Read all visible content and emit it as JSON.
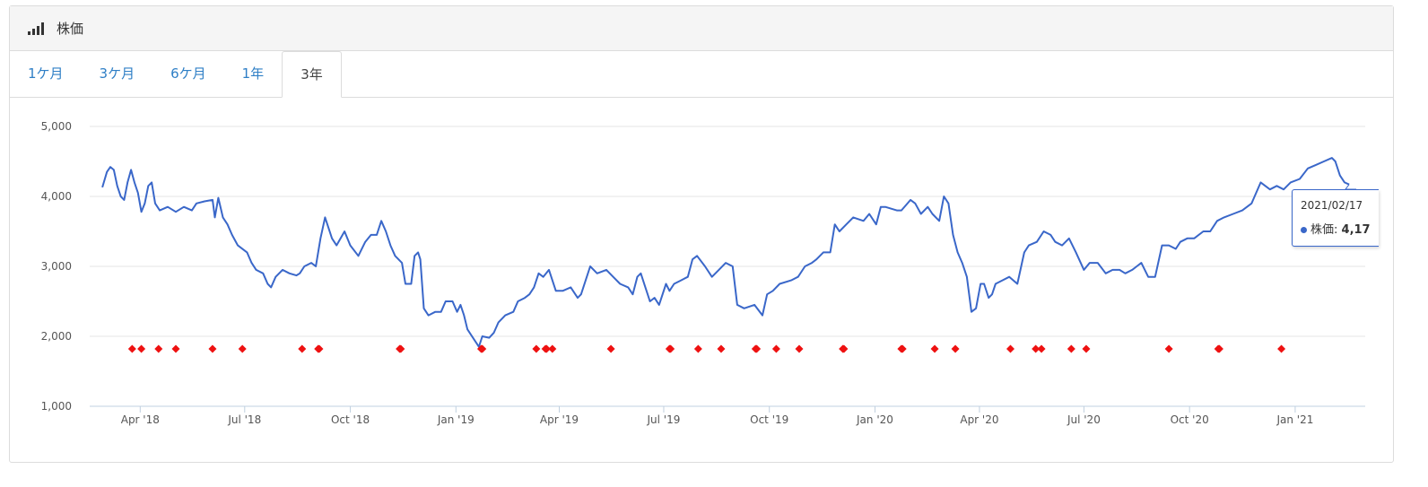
{
  "header": {
    "icon": "signal-bars-icon",
    "title": "株価"
  },
  "tabs": [
    {
      "label": "1ケ月",
      "active": false
    },
    {
      "label": "3ケ月",
      "active": false
    },
    {
      "label": "6ケ月",
      "active": false
    },
    {
      "label": "1年",
      "active": false
    },
    {
      "label": "3年",
      "active": true
    }
  ],
  "tooltip": {
    "date": "2021/02/17",
    "series_label": "株価",
    "value": "4,17"
  },
  "colors": {
    "line": "#3a67c9",
    "marker": "#ee1111",
    "grid": "#e6e6e6",
    "axis": "#c0d0e0"
  },
  "chart_data": {
    "type": "line",
    "ylim": [
      1000,
      5000
    ],
    "xlim": [
      "2018-02-16",
      "2021-03-03"
    ],
    "y_ticks": [
      "1,000",
      "2,000",
      "3,000",
      "4,000",
      "5,000"
    ],
    "x_ticks": [
      {
        "label": "Apr '18",
        "date": "2018-04-01"
      },
      {
        "label": "Jul '18",
        "date": "2018-07-01"
      },
      {
        "label": "Oct '18",
        "date": "2018-10-01"
      },
      {
        "label": "Jan '19",
        "date": "2019-01-01"
      },
      {
        "label": "Apr '19",
        "date": "2019-04-01"
      },
      {
        "label": "Jul '19",
        "date": "2019-07-01"
      },
      {
        "label": "Oct '19",
        "date": "2019-10-01"
      },
      {
        "label": "Jan '20",
        "date": "2020-01-01"
      },
      {
        "label": "Apr '20",
        "date": "2020-04-01"
      },
      {
        "label": "Jul '20",
        "date": "2020-07-01"
      },
      {
        "label": "Oct '20",
        "date": "2020-10-01"
      },
      {
        "label": "Jan '21",
        "date": "2021-01-01"
      }
    ],
    "grid": true,
    "series": [
      {
        "values": [
          [
            "2018-02-27",
            4130
          ],
          [
            "2018-03-03",
            4350
          ],
          [
            "2018-03-06",
            4420
          ],
          [
            "2018-03-09",
            4380
          ],
          [
            "2018-03-12",
            4150
          ],
          [
            "2018-03-15",
            4000
          ],
          [
            "2018-03-18",
            3950
          ],
          [
            "2018-03-21",
            4200
          ],
          [
            "2018-03-24",
            4380
          ],
          [
            "2018-03-27",
            4200
          ],
          [
            "2018-03-30",
            4050
          ],
          [
            "2018-04-02",
            3780
          ],
          [
            "2018-04-05",
            3900
          ],
          [
            "2018-04-08",
            4150
          ],
          [
            "2018-04-11",
            4200
          ],
          [
            "2018-04-14",
            3900
          ],
          [
            "2018-04-18",
            3800
          ],
          [
            "2018-04-25",
            3850
          ],
          [
            "2018-05-02",
            3780
          ],
          [
            "2018-05-09",
            3850
          ],
          [
            "2018-05-16",
            3800
          ],
          [
            "2018-05-20",
            3900
          ],
          [
            "2018-05-27",
            3930
          ],
          [
            "2018-06-03",
            3950
          ],
          [
            "2018-06-05",
            3700
          ],
          [
            "2018-06-08",
            3980
          ],
          [
            "2018-06-12",
            3700
          ],
          [
            "2018-06-16",
            3600
          ],
          [
            "2018-06-20",
            3450
          ],
          [
            "2018-06-25",
            3300
          ],
          [
            "2018-07-03",
            3200
          ],
          [
            "2018-07-07",
            3050
          ],
          [
            "2018-07-11",
            2950
          ],
          [
            "2018-07-17",
            2900
          ],
          [
            "2018-07-21",
            2750
          ],
          [
            "2018-07-24",
            2700
          ],
          [
            "2018-07-28",
            2850
          ],
          [
            "2018-08-03",
            2950
          ],
          [
            "2018-08-09",
            2900
          ],
          [
            "2018-08-15",
            2870
          ],
          [
            "2018-08-18",
            2900
          ],
          [
            "2018-08-22",
            3000
          ],
          [
            "2018-08-28",
            3050
          ],
          [
            "2018-09-01",
            3000
          ],
          [
            "2018-09-05",
            3400
          ],
          [
            "2018-09-09",
            3700
          ],
          [
            "2018-09-15",
            3400
          ],
          [
            "2018-09-19",
            3300
          ],
          [
            "2018-09-26",
            3500
          ],
          [
            "2018-10-01",
            3300
          ],
          [
            "2018-10-08",
            3150
          ],
          [
            "2018-10-14",
            3350
          ],
          [
            "2018-10-19",
            3450
          ],
          [
            "2018-10-24",
            3450
          ],
          [
            "2018-10-28",
            3650
          ],
          [
            "2018-11-01",
            3500
          ],
          [
            "2018-11-05",
            3300
          ],
          [
            "2018-11-09",
            3150
          ],
          [
            "2018-11-15",
            3050
          ],
          [
            "2018-11-18",
            2750
          ],
          [
            "2018-11-23",
            2750
          ],
          [
            "2018-11-26",
            3150
          ],
          [
            "2018-11-29",
            3200
          ],
          [
            "2018-12-01",
            3100
          ],
          [
            "2018-12-04",
            2400
          ],
          [
            "2018-12-08",
            2300
          ],
          [
            "2018-12-14",
            2350
          ],
          [
            "2018-12-19",
            2350
          ],
          [
            "2018-12-23",
            2500
          ],
          [
            "2018-12-29",
            2500
          ],
          [
            "2019-01-02",
            2350
          ],
          [
            "2019-01-05",
            2450
          ],
          [
            "2019-01-08",
            2300
          ],
          [
            "2019-01-11",
            2100
          ],
          [
            "2019-01-17",
            1950
          ],
          [
            "2019-01-21",
            1850
          ],
          [
            "2019-01-24",
            2000
          ],
          [
            "2019-01-30",
            1980
          ],
          [
            "2019-02-03",
            2050
          ],
          [
            "2019-02-07",
            2200
          ],
          [
            "2019-02-13",
            2300
          ],
          [
            "2019-02-20",
            2350
          ],
          [
            "2019-02-24",
            2500
          ],
          [
            "2019-03-02",
            2550
          ],
          [
            "2019-03-06",
            2600
          ],
          [
            "2019-03-10",
            2700
          ],
          [
            "2019-03-14",
            2900
          ],
          [
            "2019-03-18",
            2850
          ],
          [
            "2019-03-23",
            2950
          ],
          [
            "2019-03-29",
            2650
          ],
          [
            "2019-04-04",
            2650
          ],
          [
            "2019-04-11",
            2700
          ],
          [
            "2019-04-17",
            2550
          ],
          [
            "2019-04-20",
            2600
          ],
          [
            "2019-04-24",
            2800
          ],
          [
            "2019-04-28",
            3000
          ],
          [
            "2019-05-04",
            2900
          ],
          [
            "2019-05-12",
            2950
          ],
          [
            "2019-05-18",
            2850
          ],
          [
            "2019-05-24",
            2750
          ],
          [
            "2019-05-31",
            2700
          ],
          [
            "2019-06-04",
            2600
          ],
          [
            "2019-06-08",
            2850
          ],
          [
            "2019-06-11",
            2900
          ],
          [
            "2019-06-15",
            2700
          ],
          [
            "2019-06-19",
            2500
          ],
          [
            "2019-06-23",
            2550
          ],
          [
            "2019-06-27",
            2450
          ],
          [
            "2019-07-03",
            2750
          ],
          [
            "2019-07-06",
            2650
          ],
          [
            "2019-07-10",
            2750
          ],
          [
            "2019-07-16",
            2800
          ],
          [
            "2019-07-22",
            2850
          ],
          [
            "2019-07-26",
            3100
          ],
          [
            "2019-07-30",
            3150
          ],
          [
            "2019-08-06",
            3000
          ],
          [
            "2019-08-12",
            2850
          ],
          [
            "2019-08-18",
            2950
          ],
          [
            "2019-08-24",
            3050
          ],
          [
            "2019-08-30",
            3000
          ],
          [
            "2019-09-03",
            2450
          ],
          [
            "2019-09-09",
            2400
          ],
          [
            "2019-09-18",
            2450
          ],
          [
            "2019-09-25",
            2300
          ],
          [
            "2019-09-29",
            2600
          ],
          [
            "2019-10-04",
            2650
          ],
          [
            "2019-10-10",
            2750
          ],
          [
            "2019-10-20",
            2800
          ],
          [
            "2019-10-26",
            2850
          ],
          [
            "2019-11-01",
            3000
          ],
          [
            "2019-11-07",
            3050
          ],
          [
            "2019-11-11",
            3100
          ],
          [
            "2019-11-17",
            3200
          ],
          [
            "2019-11-23",
            3200
          ],
          [
            "2019-11-27",
            3600
          ],
          [
            "2019-12-01",
            3500
          ],
          [
            "2019-12-07",
            3600
          ],
          [
            "2019-12-13",
            3700
          ],
          [
            "2019-12-22",
            3650
          ],
          [
            "2019-12-27",
            3750
          ],
          [
            "2020-01-02",
            3600
          ],
          [
            "2020-01-06",
            3850
          ],
          [
            "2020-01-10",
            3850
          ],
          [
            "2020-01-20",
            3800
          ],
          [
            "2020-01-24",
            3800
          ],
          [
            "2020-02-01",
            3950
          ],
          [
            "2020-02-05",
            3900
          ],
          [
            "2020-02-10",
            3750
          ],
          [
            "2020-02-16",
            3850
          ],
          [
            "2020-02-20",
            3750
          ],
          [
            "2020-02-26",
            3650
          ],
          [
            "2020-03-01",
            4000
          ],
          [
            "2020-03-05",
            3900
          ],
          [
            "2020-03-09",
            3450
          ],
          [
            "2020-03-13",
            3200
          ],
          [
            "2020-03-17",
            3050
          ],
          [
            "2020-03-21",
            2850
          ],
          [
            "2020-03-25",
            2350
          ],
          [
            "2020-03-29",
            2400
          ],
          [
            "2020-04-02",
            2750
          ],
          [
            "2020-04-05",
            2750
          ],
          [
            "2020-04-09",
            2550
          ],
          [
            "2020-04-12",
            2600
          ],
          [
            "2020-04-15",
            2750
          ],
          [
            "2020-04-21",
            2800
          ],
          [
            "2020-04-27",
            2850
          ],
          [
            "2020-05-04",
            2750
          ],
          [
            "2020-05-10",
            3200
          ],
          [
            "2020-05-14",
            3300
          ],
          [
            "2020-05-21",
            3350
          ],
          [
            "2020-05-27",
            3500
          ],
          [
            "2020-06-02",
            3450
          ],
          [
            "2020-06-06",
            3350
          ],
          [
            "2020-06-12",
            3300
          ],
          [
            "2020-06-18",
            3400
          ],
          [
            "2020-06-24",
            3200
          ],
          [
            "2020-07-01",
            2950
          ],
          [
            "2020-07-06",
            3050
          ],
          [
            "2020-07-13",
            3050
          ],
          [
            "2020-07-20",
            2900
          ],
          [
            "2020-07-26",
            2950
          ],
          [
            "2020-08-01",
            2950
          ],
          [
            "2020-08-06",
            2900
          ],
          [
            "2020-08-12",
            2950
          ],
          [
            "2020-08-16",
            3000
          ],
          [
            "2020-08-20",
            3050
          ],
          [
            "2020-08-26",
            2850
          ],
          [
            "2020-09-01",
            2850
          ],
          [
            "2020-09-07",
            3300
          ],
          [
            "2020-09-13",
            3300
          ],
          [
            "2020-09-19",
            3250
          ],
          [
            "2020-09-23",
            3350
          ],
          [
            "2020-09-29",
            3400
          ],
          [
            "2020-10-05",
            3400
          ],
          [
            "2020-10-13",
            3500
          ],
          [
            "2020-10-19",
            3500
          ],
          [
            "2020-10-25",
            3650
          ],
          [
            "2020-10-31",
            3700
          ],
          [
            "2020-11-08",
            3750
          ],
          [
            "2020-11-16",
            3800
          ],
          [
            "2020-11-24",
            3900
          ],
          [
            "2020-12-02",
            4200
          ],
          [
            "2020-12-10",
            4100
          ],
          [
            "2020-12-16",
            4150
          ],
          [
            "2020-12-22",
            4100
          ],
          [
            "2020-12-28",
            4200
          ],
          [
            "2021-01-05",
            4250
          ],
          [
            "2021-01-12",
            4400
          ],
          [
            "2021-01-19",
            4450
          ],
          [
            "2021-01-26",
            4500
          ],
          [
            "2021-02-02",
            4550
          ],
          [
            "2021-02-05",
            4500
          ],
          [
            "2021-02-09",
            4300
          ],
          [
            "2021-02-13",
            4200
          ],
          [
            "2021-02-17",
            4170
          ]
        ]
      },
      {
        "marker": "diamond",
        "values": [
          [
            "2018-03-25",
            1820
          ],
          [
            "2018-04-02",
            1820
          ],
          [
            "2018-04-17",
            1820
          ],
          [
            "2018-05-02",
            1820
          ],
          [
            "2018-06-03",
            1820
          ],
          [
            "2018-06-29",
            1820
          ],
          [
            "2018-08-20",
            1820
          ],
          [
            "2018-09-03",
            1820
          ],
          [
            "2018-09-04",
            1820
          ],
          [
            "2018-11-13",
            1820
          ],
          [
            "2018-11-14",
            1820
          ],
          [
            "2019-01-23",
            1820
          ],
          [
            "2019-01-24",
            1820
          ],
          [
            "2019-03-12",
            1820
          ],
          [
            "2019-03-20",
            1820
          ],
          [
            "2019-03-21",
            1820
          ],
          [
            "2019-03-26",
            1820
          ],
          [
            "2019-05-16",
            1820
          ],
          [
            "2019-07-06",
            1820
          ],
          [
            "2019-07-07",
            1820
          ],
          [
            "2019-07-31",
            1820
          ],
          [
            "2019-08-20",
            1820
          ],
          [
            "2019-09-19",
            1820
          ],
          [
            "2019-09-20",
            1820
          ],
          [
            "2019-10-07",
            1820
          ],
          [
            "2019-10-27",
            1820
          ],
          [
            "2019-12-04",
            1820
          ],
          [
            "2019-12-05",
            1820
          ],
          [
            "2020-01-24",
            1820
          ],
          [
            "2020-01-25",
            1820
          ],
          [
            "2020-02-22",
            1820
          ],
          [
            "2020-03-11",
            1820
          ],
          [
            "2020-04-28",
            1820
          ],
          [
            "2020-05-20",
            1820
          ],
          [
            "2020-05-25",
            1820
          ],
          [
            "2020-06-20",
            1820
          ],
          [
            "2020-07-03",
            1820
          ],
          [
            "2020-09-13",
            1820
          ],
          [
            "2020-10-26",
            1820
          ],
          [
            "2020-10-27",
            1820
          ],
          [
            "2020-12-20",
            1820
          ]
        ]
      }
    ]
  }
}
